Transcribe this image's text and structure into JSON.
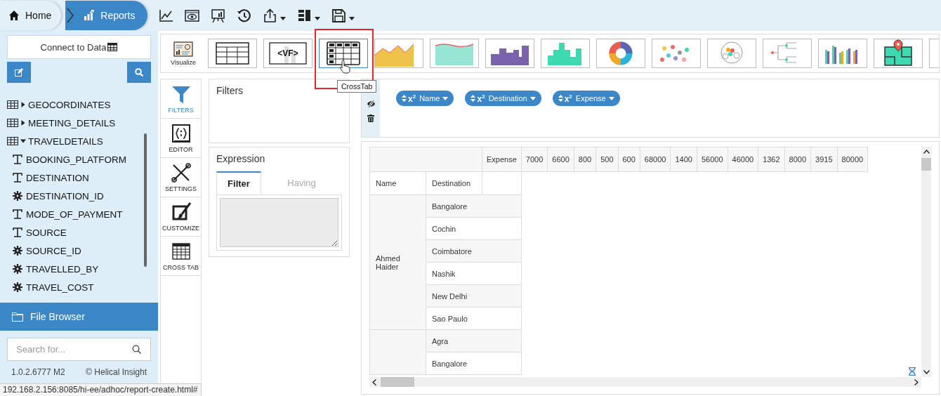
{
  "breadcrumb": [
    {
      "label": "Home",
      "kind": "home",
      "selected": false
    },
    {
      "label": "Reports",
      "kind": "reports",
      "selected": true
    }
  ],
  "sidebar": {
    "connect_button": "Connect to Data",
    "fields": [
      {
        "label": "GEOCORDINATES",
        "kind": "table",
        "expanded": false
      },
      {
        "label": "MEETING_DETAILS",
        "kind": "table",
        "expanded": false
      },
      {
        "label": "TRAVELDETAILS",
        "kind": "table",
        "expanded": true,
        "children": [
          {
            "label": "BOOKING_PLATFORM",
            "kind": "text"
          },
          {
            "label": "DESTINATION",
            "kind": "text"
          },
          {
            "label": "DESTINATION_ID",
            "kind": "number"
          },
          {
            "label": "MODE_OF_PAYMENT",
            "kind": "text"
          },
          {
            "label": "SOURCE",
            "kind": "text"
          },
          {
            "label": "SOURCE_ID",
            "kind": "number"
          },
          {
            "label": "TRAVELLED_BY",
            "kind": "number"
          },
          {
            "label": "TRAVEL_COST",
            "kind": "number"
          }
        ]
      }
    ],
    "file_browser": "File Browser",
    "search": {
      "placeholder": "Search for..."
    },
    "version": "1.0.2.6777 M2",
    "copyright": "© Helical Insight"
  },
  "status_url": "192.168.2.156:8085/hi-ee/adhoc/report-create.html#",
  "visualize": {
    "label": "Visualize",
    "tooltip": "CrossTab",
    "charts": [
      {
        "kind": "table",
        "selected": false
      },
      {
        "kind": "vf",
        "label": "<VF>",
        "selected": false
      },
      {
        "kind": "crosstab",
        "selected": true
      },
      {
        "kind": "line-area",
        "selected": false
      },
      {
        "kind": "area",
        "selected": false
      },
      {
        "kind": "step",
        "selected": false
      },
      {
        "kind": "histogram",
        "selected": false
      },
      {
        "kind": "donut",
        "selected": false
      },
      {
        "kind": "scatter",
        "selected": false
      },
      {
        "kind": "pack",
        "selected": false
      },
      {
        "kind": "tree",
        "selected": false
      },
      {
        "kind": "grouped-bar",
        "selected": false
      },
      {
        "kind": "map",
        "selected": false
      },
      {
        "kind": "blank",
        "selected": false
      }
    ]
  },
  "tools": [
    {
      "label": "FILTERS",
      "kind": "filter",
      "selected": true
    },
    {
      "label": "EDITOR",
      "kind": "editor",
      "selected": false
    },
    {
      "label": "SETTINGS",
      "kind": "settings",
      "selected": false
    },
    {
      "label": "CUSTOMIZE",
      "kind": "customize",
      "selected": false
    },
    {
      "label": "CROSS TAB",
      "kind": "crosstab",
      "selected": false
    }
  ],
  "filters_panel": {
    "title": "Filters"
  },
  "expression": {
    "title": "Expression",
    "tabs": [
      {
        "label": "Filter",
        "selected": true
      },
      {
        "label": "Having",
        "selected": false
      }
    ]
  },
  "chips": [
    {
      "label": "Name",
      "prefix": "x$^{2}$"
    },
    {
      "label": "Destination",
      "prefix": "x$^{2}$"
    },
    {
      "label": "Expense",
      "prefix": "x$^{2}$"
    }
  ],
  "crosstab": {
    "measure": "Expense",
    "columns": [
      "7000",
      "6600",
      "800",
      "500",
      "600",
      "68000",
      "1400",
      "56000",
      "46000",
      "1362",
      "8000",
      "3915",
      "80000"
    ],
    "row_headers": [
      "Name",
      "Destination"
    ],
    "groups": [
      {
        "name": "Ahmed Haider",
        "rows": [
          "Bangalore",
          "Cochin",
          "Coimbatore",
          "Nashik",
          "New Delhi",
          "Sao Paulo"
        ]
      },
      {
        "rows": [
          "Agra",
          "Bangalore"
        ]
      }
    ]
  }
}
